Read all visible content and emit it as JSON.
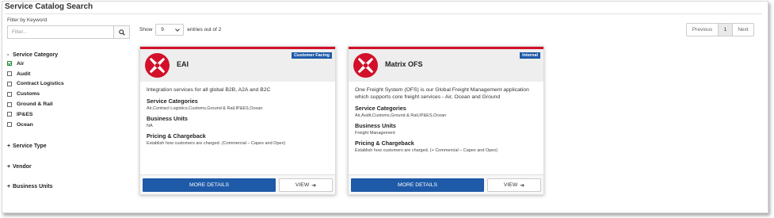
{
  "page": {
    "title": "Service Catalog Search"
  },
  "sidebar": {
    "filter_label": "Filter by Keyword",
    "filter_placeholder": "Filter...",
    "service_category": {
      "label": "Service Category",
      "sign": "-",
      "items": [
        {
          "label": "Air",
          "checked": true
        },
        {
          "label": "Audit",
          "checked": false
        },
        {
          "label": "Contract Logistics",
          "checked": false
        },
        {
          "label": "Customs",
          "checked": false
        },
        {
          "label": "Ground & Rail",
          "checked": false
        },
        {
          "label": "IP&ES",
          "checked": false
        },
        {
          "label": "Ocean",
          "checked": false
        }
      ]
    },
    "service_type": {
      "label": "Service Type",
      "sign": "+"
    },
    "vendor": {
      "label": "Vendor",
      "sign": "+"
    },
    "business_units": {
      "label": "Business Units",
      "sign": "+"
    }
  },
  "toolbar": {
    "show_label": "Show",
    "show_value": "9",
    "entries_text": "entries out of 2"
  },
  "pagination": {
    "previous": "Previous",
    "current": "1",
    "next": "Next"
  },
  "cards": [
    {
      "name": "EAI",
      "badge": "Customer Facing",
      "description": "Integration services for all global B2B, A2A and B2C",
      "categories_label": "Service Categories",
      "categories": "Air,Contract Logistics,Customs,Ground & Rail,IP&ES,Ocean",
      "units_label": "Business Units",
      "units": "NA",
      "pricing_label": "Pricing & Chargeback",
      "pricing": "Establish how customers are charged. (Commercial – Capex and Opex)",
      "more_label": "MORE DETAILS",
      "view_label": "VIEW"
    },
    {
      "name": "Matrix OFS",
      "badge": "Internal",
      "description": "One Freight System (OFS) is our Global Freight Management application which supports core freight services - Air, Ocean and Ground",
      "categories_label": "Service Categories",
      "categories": "Air,Audit,Customs,Ground & Rail,IP&ES,Ocean",
      "units_label": "Business Units",
      "units": "Freight Management",
      "pricing_label": "Pricing & Chargeback",
      "pricing": "Establish how customers are charged. (+ Commercial – Capex and Opex)",
      "more_label": "MORE DETAILS",
      "view_label": "VIEW"
    }
  ],
  "colors": {
    "accent": "#d2102a",
    "primary_button": "#1e5aa8",
    "badge": "#1e5aa8",
    "check": "#2a8a3a"
  },
  "icons": [
    "search-icon",
    "chevron-down-icon",
    "arrow-right-icon",
    "brand-logo-icon",
    "checkbox-icon"
  ]
}
